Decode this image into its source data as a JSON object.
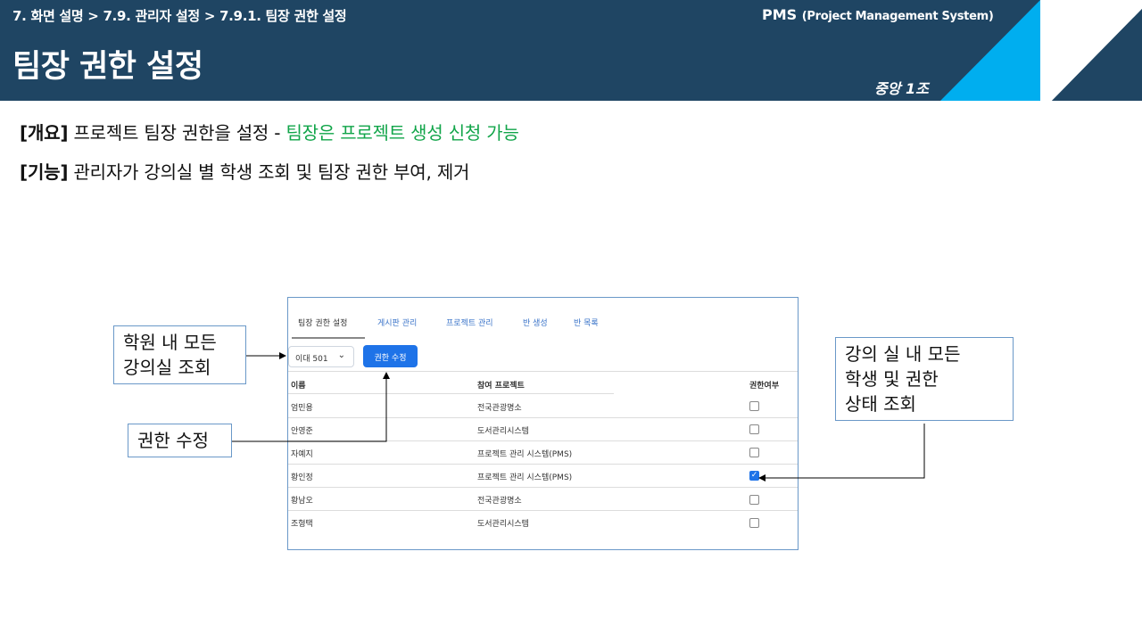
{
  "header": {
    "breadcrumb": "7. 화면 설명 > 7.9. 관리자 설정 > 7.9.1. 팀장 권한 설정",
    "title": "팀장 권한 설정",
    "brand_main": "PMS",
    "brand_sub": "(Project Management System)",
    "team": "중앙 1조"
  },
  "description": {
    "overview_tag": "[개요]",
    "overview_text": " 프로젝트 팀장 권한을 설정 - ",
    "overview_highlight": "팀장은 프로젝트 생성 신청 가능",
    "function_tag": "[기능]",
    "function_text": " 관리자가 강의실 별 학생 조회 및 팀장 권한 부여, 제거"
  },
  "app": {
    "tabs": [
      {
        "label": "팀장 권한 설정",
        "active": true
      },
      {
        "label": "게시판 관리",
        "active": false
      },
      {
        "label": "프로젝트 관리",
        "active": false
      },
      {
        "label": "반 생성",
        "active": false
      },
      {
        "label": "반 목록",
        "active": false
      }
    ],
    "classroom_select": "이대 501",
    "edit_button": "권한 수정",
    "columns": {
      "name": "이름",
      "project": "참여 프로젝트",
      "permission": "권한여부"
    },
    "rows": [
      {
        "name": "엄민용",
        "project": "전국관광명소",
        "permission": false
      },
      {
        "name": "안영준",
        "project": "도서관리시스템",
        "permission": false
      },
      {
        "name": "자예지",
        "project": "프로젝트 관리 시스템(PMS)",
        "permission": false
      },
      {
        "name": "황인정",
        "project": "프로젝트 관리 시스템(PMS)",
        "permission": true
      },
      {
        "name": "황남오",
        "project": "전국관광명소",
        "permission": false
      },
      {
        "name": "조형택",
        "project": "도서관리시스템",
        "permission": false
      }
    ]
  },
  "callouts": {
    "classroom": [
      "학원 내 모든",
      "강의실 조회"
    ],
    "edit": [
      "권한 수정"
    ],
    "students": [
      "강의 실 내 모든",
      "학생 및 권한",
      "상태 조회"
    ]
  },
  "colors": {
    "header_bg": "#1f4563",
    "accent_cyan": "#00aeef",
    "highlight_green": "#12a54a",
    "primary_button": "#1e73e8"
  }
}
